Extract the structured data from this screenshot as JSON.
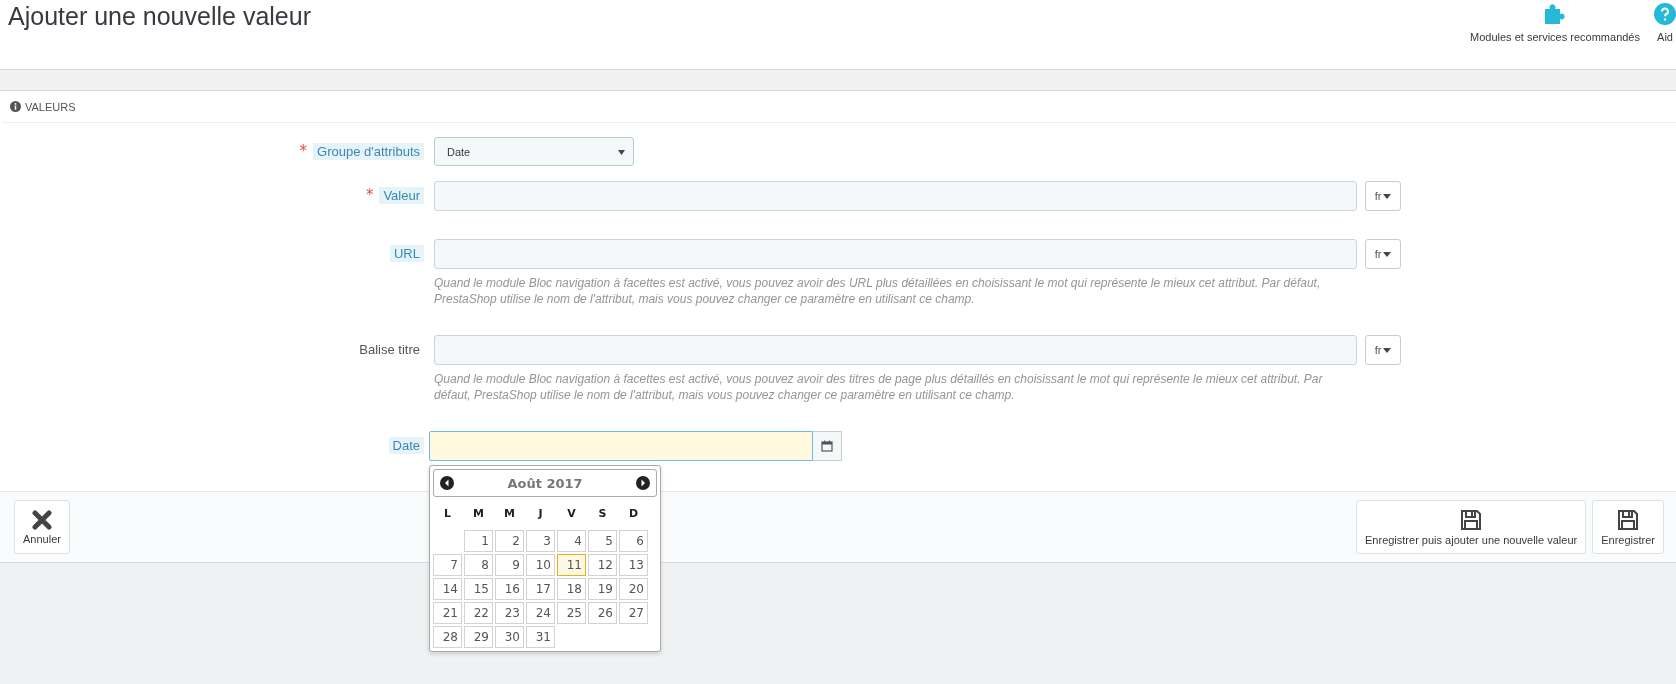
{
  "header": {
    "title": "Ajouter une nouvelle valeur",
    "toolbar": [
      {
        "kind": "modules",
        "label": "Modules et services recommandés"
      },
      {
        "kind": "help",
        "label": "Aid"
      }
    ]
  },
  "panel": {
    "heading": "VALEURS",
    "fields": [
      {
        "kind": "select",
        "label": "Groupe d'attributs",
        "required_mark": "*",
        "tooltip": true,
        "value": "Date"
      },
      {
        "kind": "lang",
        "label": "Valeur",
        "required_mark": "*",
        "tooltip": true,
        "lang": "fr"
      },
      {
        "kind": "lang",
        "label": "URL",
        "tooltip": true,
        "lang": "fr",
        "help": "Quand le module Bloc navigation à facettes est activé, vous pouvez avoir des URL plus détaillées en choisissant le mot qui représente le mieux cet attribut. Par défaut, PrestaShop utilise le nom de l'attribut, mais vous pouvez changer ce paramètre en utilisant ce champ."
      },
      {
        "kind": "lang",
        "label": "Balise titre",
        "tooltip": false,
        "lang": "fr",
        "help": "Quand le module Bloc navigation à facettes est activé, vous pouvez avoir des titres de page plus détaillés en choisissant le mot qui représente le mieux cet attribut. Par défaut, PrestaShop utilise le nom de l'attribut, mais vous pouvez changer ce paramètre en utilisant ce champ."
      },
      {
        "kind": "date",
        "label": "Date",
        "tooltip": true
      }
    ],
    "calendar": {
      "month": "Août 2017",
      "weekdays": [
        "L",
        "M",
        "M",
        "J",
        "V",
        "S",
        "D"
      ],
      "weeks": [
        [
          {
            "day": "1",
            "selected": false
          },
          {
            "day": "2",
            "selected": false
          },
          {
            "day": "3",
            "selected": false
          },
          {
            "day": "4",
            "selected": false
          },
          {
            "day": "5",
            "selected": false
          },
          {
            "day": "6",
            "selected": false
          }
        ],
        [
          {
            "day": "7",
            "selected": false
          },
          {
            "day": "8",
            "selected": false
          },
          {
            "day": "9",
            "selected": false
          },
          {
            "day": "10",
            "selected": false
          },
          {
            "day": "11",
            "selected": true
          },
          {
            "day": "12",
            "selected": false
          },
          {
            "day": "13",
            "selected": false
          }
        ],
        [
          {
            "day": "14",
            "selected": false
          },
          {
            "day": "15",
            "selected": false
          },
          {
            "day": "16",
            "selected": false
          },
          {
            "day": "17",
            "selected": false
          },
          {
            "day": "18",
            "selected": false
          },
          {
            "day": "19",
            "selected": false
          },
          {
            "day": "20",
            "selected": false
          }
        ],
        [
          {
            "day": "21",
            "selected": false
          },
          {
            "day": "22",
            "selected": false
          },
          {
            "day": "23",
            "selected": false
          },
          {
            "day": "24",
            "selected": false
          },
          {
            "day": "25",
            "selected": false
          },
          {
            "day": "26",
            "selected": false
          },
          {
            "day": "27",
            "selected": false
          }
        ],
        [
          {
            "day": "28",
            "selected": false
          },
          {
            "day": "29",
            "selected": false
          },
          {
            "day": "30",
            "selected": false
          },
          {
            "day": "31",
            "selected": false
          }
        ]
      ]
    },
    "footer": {
      "left": [
        {
          "kind": "cancel",
          "label": "Annuler"
        }
      ],
      "right": [
        {
          "kind": "save",
          "label": "Enregistrer puis ajouter une nouvelle valeur"
        },
        {
          "kind": "save",
          "label": "Enregistrer"
        }
      ]
    }
  }
}
